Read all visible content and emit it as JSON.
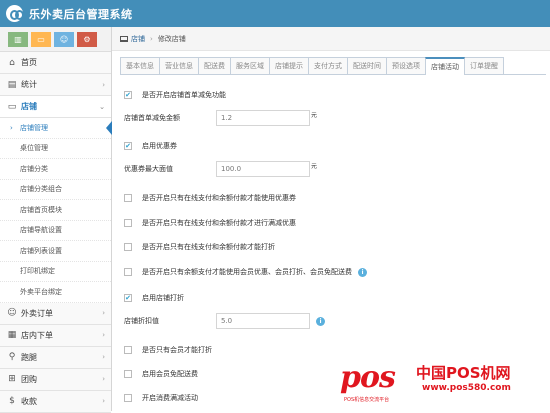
{
  "app": {
    "title": "乐外卖后台管理系统"
  },
  "shortcuts": [
    {
      "icon": "chart-icon"
    },
    {
      "icon": "monitor-icon"
    },
    {
      "icon": "users-icon"
    },
    {
      "icon": "cogs-icon"
    }
  ],
  "sidebar": {
    "items": [
      {
        "label": "首页",
        "icon": "home-icon"
      },
      {
        "label": "统计",
        "icon": "bar-chart-icon"
      }
    ],
    "open": {
      "label": "店铺",
      "icon": "desktop-icon"
    },
    "subitems": [
      "店铺管理",
      "桌位管理",
      "店铺分类",
      "店铺分类组合",
      "店铺首页模块",
      "店铺导航设置",
      "店铺列表设置",
      "打印机绑定",
      "外卖平台绑定"
    ],
    "bottom": [
      {
        "label": "外卖订单",
        "icon": "smile-icon"
      },
      {
        "label": "店内下单",
        "icon": "calendar-icon"
      },
      {
        "label": "跑腿",
        "icon": "bicycle-icon"
      },
      {
        "label": "团购",
        "icon": "cart-icon"
      },
      {
        "label": "收款",
        "icon": "dollar-icon"
      }
    ]
  },
  "breadcrumb": {
    "home": "店铺",
    "current": "修改店铺"
  },
  "tabs": [
    "基本信息",
    "营业信息",
    "配送费",
    "服务区域",
    "店铺提示",
    "支付方式",
    "配送时间",
    "预设选项",
    "店铺活动",
    "订单提醒"
  ],
  "active_tab": "店铺活动",
  "form": {
    "first_order": {
      "label": "是否开启店铺首单减免功能",
      "checked": true
    },
    "first_order_amount": {
      "label": "店铺首单减免金额",
      "value": "1.2",
      "unit": "元"
    },
    "coupon": {
      "label": "启用优惠券",
      "checked": true
    },
    "coupon_max": {
      "label": "优惠券最大面值",
      "value": "100.0",
      "unit": "元"
    },
    "opt1": {
      "label": "是否开启只有在线支付和余额付款才能使用优惠券",
      "checked": false
    },
    "opt2": {
      "label": "是否开启只有在线支付和余额付款才进行满减优惠",
      "checked": false
    },
    "opt3": {
      "label": "是否开启只有在线支付和余额付款才能打折",
      "checked": false
    },
    "opt4": {
      "label": "是否开启只有余额支付才能使用会员优惠、会员打折、会员免配送费",
      "checked": false
    },
    "discount": {
      "label": "启用店铺打折",
      "checked": true
    },
    "discount_value": {
      "label": "店铺折扣值",
      "value": "5.0"
    },
    "opt5": {
      "label": "是否只有会员才能打折",
      "checked": false
    },
    "opt6": {
      "label": "启用会员免配送费",
      "checked": false
    },
    "opt7": {
      "label": "开启消费满减活动",
      "checked": false
    }
  },
  "watermark": {
    "logo": "pos",
    "name": "中国POS机网",
    "url": "www.pos580.com",
    "sub": "POS机信息交流平台"
  },
  "colors": {
    "header": "#438eb9",
    "accent": "#2b7dbc",
    "check": "#32a3ce",
    "watermark": "#e0161f"
  }
}
